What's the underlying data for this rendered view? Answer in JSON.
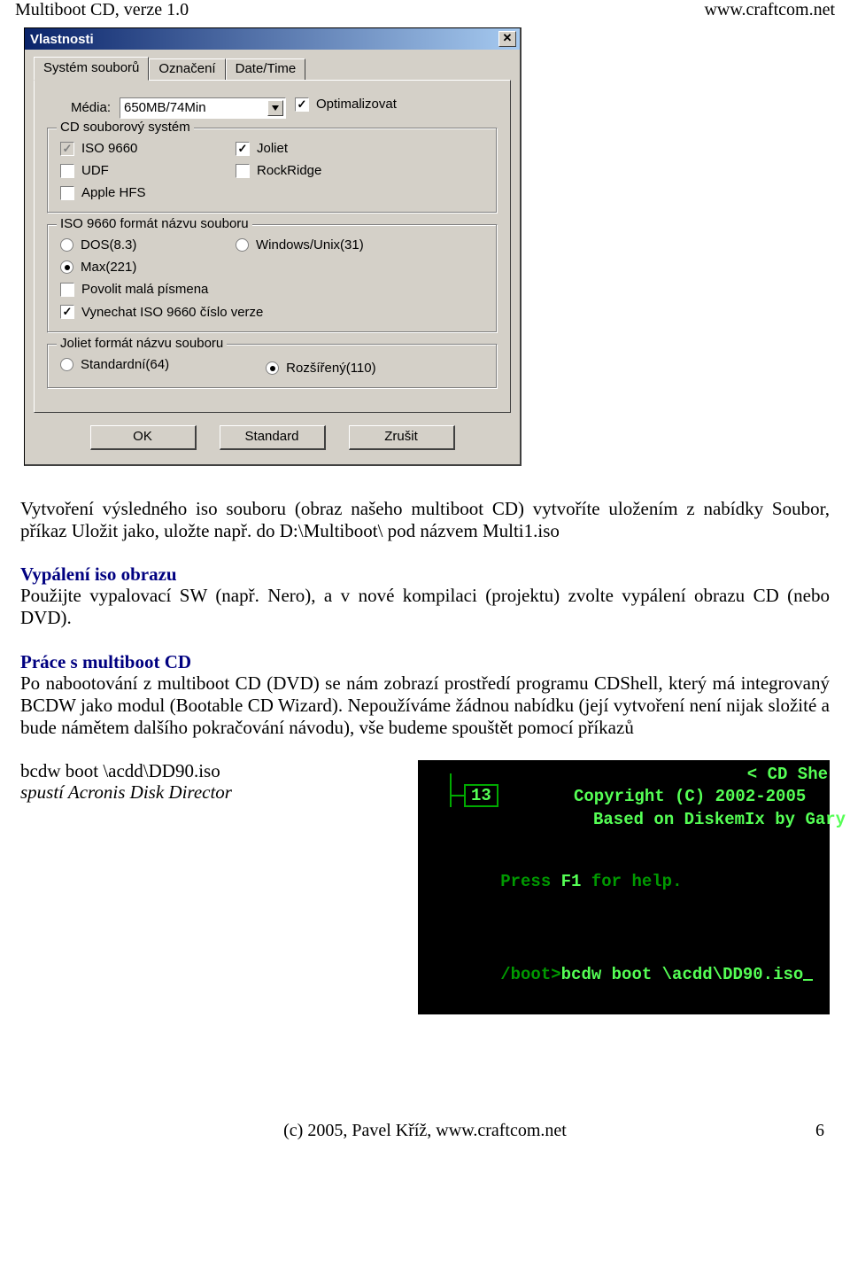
{
  "header": {
    "left": "Multiboot CD, verze 1.0",
    "right": "www.craftcom.net"
  },
  "dialog": {
    "title": "Vlastnosti",
    "tabs": [
      "Systém souborů",
      "Označení",
      "Date/Time"
    ],
    "media_label": "Média:",
    "media_value": "650MB/74Min",
    "optimize_label": "Optimalizovat",
    "group_fs": {
      "legend": "CD souborový systém",
      "iso": "ISO 9660",
      "joliet": "Joliet",
      "udf": "UDF",
      "rockridge": "RockRidge",
      "apple": "Apple HFS"
    },
    "group_iso": {
      "legend": "ISO 9660 formát názvu souboru",
      "dos": "DOS(8.3)",
      "win": "Windows/Unix(31)",
      "max": "Max(221)",
      "lowercase": "Povolit malá písmena",
      "omit": "Vynechat ISO 9660 číslo verze"
    },
    "group_joliet": {
      "legend": "Joliet formát názvu souboru",
      "std": "Standardní(64)",
      "ext": "Rozšířený(110)"
    },
    "buttons": {
      "ok": "OK",
      "std": "Standard",
      "cancel": "Zrušit"
    }
  },
  "doc": {
    "p1": "Vytvoření výsledného iso souboru (obraz našeho multiboot CD) vytvoříte uložením z nabídky Soubor, příkaz Uložit jako, uložte např. do D:\\Multiboot\\ pod názvem Multi1.iso",
    "h2": "Vypálení iso obrazu",
    "p2": "Použijte vypalovací SW (např. Nero), a v nové kompilaci (projektu) zvolte vypálení obrazu CD (nebo DVD).",
    "h3": "Práce s multiboot CD",
    "p3": "Po nabootování z multiboot CD (DVD) se nám zobrazí prostředí programu CDShell, který má integrovaný BCDW jako modul (Bootable CD Wizard). Nepoužíváme žádnou nabídku (její vytvoření není nijak složité a bude námětem dalšího pokračování návodu), vše budeme spouštět pomocí příkazů",
    "cmd": "bcdw boot \\acdd\\DD90.iso",
    "cmd_desc": "spustí Acronis Disk Director"
  },
  "console": {
    "topright": "< CD She",
    "box": "13",
    "copyright": "Copyright (C) 2002-2005",
    "based": "Based on DiskemIx by Gary",
    "help_pre": "Press ",
    "help_key": "F1",
    "help_post": " for help.",
    "prompt": "/boot>",
    "cmd": "bcdw boot \\acdd\\DD90.iso"
  },
  "footer": {
    "center": "(c) 2005, Pavel Kříž, www.craftcom.net",
    "page": "6"
  }
}
